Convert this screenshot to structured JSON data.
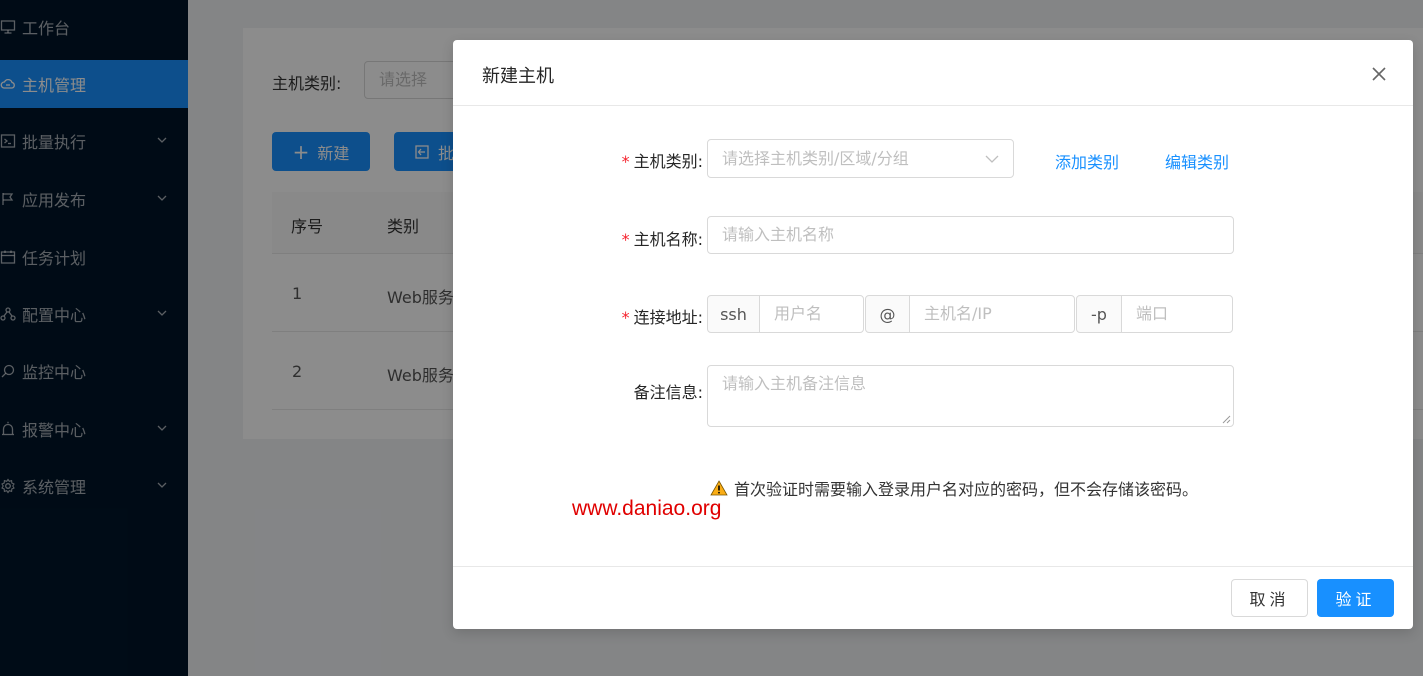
{
  "sidebar": {
    "items": [
      {
        "label": "工作台",
        "icon": "monitor-icon",
        "has_arrow": false
      },
      {
        "label": "主机管理",
        "icon": "cloud-icon",
        "has_arrow": false,
        "active": true
      },
      {
        "label": "批量执行",
        "icon": "terminal-icon",
        "has_arrow": true
      },
      {
        "label": "应用发布",
        "icon": "flag-icon",
        "has_arrow": true
      },
      {
        "label": "任务计划",
        "icon": "calendar-icon",
        "has_arrow": false
      },
      {
        "label": "配置中心",
        "icon": "cluster-icon",
        "has_arrow": true
      },
      {
        "label": "监控中心",
        "icon": "search-icon",
        "has_arrow": false
      },
      {
        "label": "报警中心",
        "icon": "alarm-icon",
        "has_arrow": true
      },
      {
        "label": "系统管理",
        "icon": "gear-icon",
        "has_arrow": true
      }
    ]
  },
  "background": {
    "filter_label": "主机类别:",
    "filter_placeholder": "请选择",
    "new_button": "新建",
    "batch_button": "批",
    "columns": [
      "序号",
      "类别"
    ],
    "rows": [
      {
        "index": "1",
        "category": "Web服务"
      },
      {
        "index": "2",
        "category": "Web服务"
      }
    ]
  },
  "modal": {
    "title": "新建主机",
    "fields": {
      "category_label": "主机类别:",
      "category_placeholder": "请选择主机类别/区域/分组",
      "add_category": "添加类别",
      "edit_category": "编辑类别",
      "name_label": "主机名称:",
      "name_placeholder": "请输入主机名称",
      "addr_label": "连接地址:",
      "addr_prefix": "ssh",
      "user_placeholder": "用户名",
      "at": "@",
      "host_placeholder": "主机名/IP",
      "port_prefix": "-p",
      "port_placeholder": "端口",
      "desc_label": "备注信息:",
      "desc_placeholder": "请输入主机备注信息"
    },
    "tip": "首次验证时需要输入登录用户名对应的密码，但不会存储该密码。",
    "watermark": "www.daniao.org",
    "cancel": "取消",
    "ok": "验证"
  },
  "colors": {
    "primary": "#1890ff",
    "sidebar": "#001529",
    "required": "#f5222d",
    "watermark": "#e00000"
  }
}
